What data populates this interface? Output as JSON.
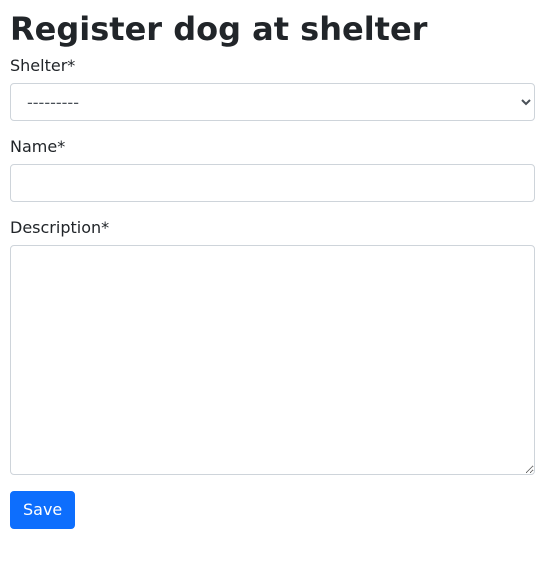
{
  "page": {
    "title": "Register dog at shelter"
  },
  "form": {
    "shelter": {
      "label": "Shelter*",
      "selected": "---------",
      "options": [
        "---------"
      ]
    },
    "name": {
      "label": "Name*",
      "value": ""
    },
    "description": {
      "label": "Description*",
      "value": ""
    },
    "submit_label": "Save"
  }
}
